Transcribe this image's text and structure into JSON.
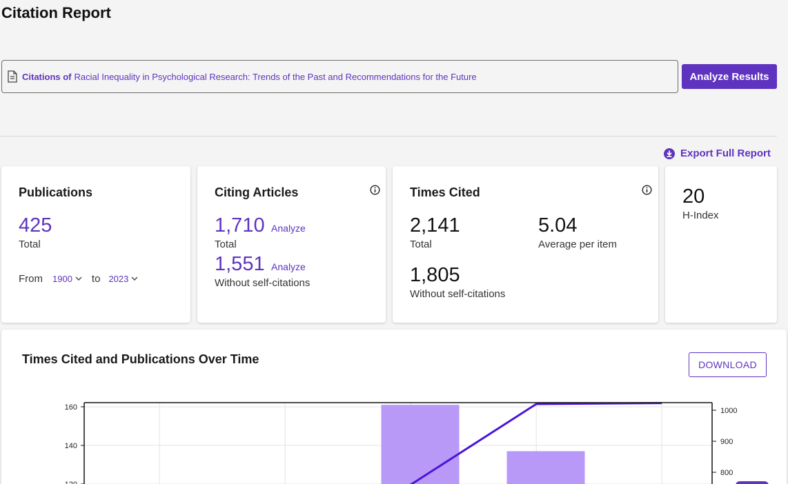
{
  "page": {
    "title": "Citation Report"
  },
  "citation": {
    "prefix": "Citations of",
    "title": "Racial Inequality in Psychological Research: Trends of the Past and Recommendations for the Future"
  },
  "actions": {
    "analyze_results": "Analyze Results",
    "export_full_report": "Export Full Report"
  },
  "publications": {
    "title": "Publications",
    "total": "425",
    "total_label": "Total",
    "from_label": "From",
    "from_year": "1900",
    "to_label": "to",
    "to_year": "2023"
  },
  "citing_articles": {
    "title": "Citing Articles",
    "total": "1,710",
    "total_analyze": "Analyze",
    "total_label": "Total",
    "without_self": "1,551",
    "without_self_analyze": "Analyze",
    "without_self_label": "Without self-citations"
  },
  "times_cited": {
    "title": "Times Cited",
    "total": "2,141",
    "total_label": "Total",
    "average": "5.04",
    "average_label": "Average per item",
    "without_self": "1,805",
    "without_self_label": "Without self-citations"
  },
  "h_index": {
    "value": "20",
    "label": "H-Index"
  },
  "chart_section": {
    "title": "Times Cited and Publications Over Time",
    "download_label": "DOWNLOAD"
  },
  "colors": {
    "accent": "#5e33bf",
    "bar": "#b899f7",
    "line": "#4a14d6"
  },
  "icons": [
    "document-icon",
    "download-circle-icon",
    "info-icon",
    "chevron-down-icon"
  ],
  "chart_data": {
    "type": "bar",
    "title": "Times Cited and Publications Over Time",
    "left_axis": {
      "ticks": [
        120,
        140,
        160
      ],
      "range": [
        120,
        161
      ]
    },
    "right_axis": {
      "ticks": [
        800,
        900,
        1000
      ],
      "range": [
        770,
        1025
      ]
    },
    "categories": [
      "",
      "",
      "",
      "",
      ""
    ],
    "series": [
      {
        "axis": "left",
        "type": "bar",
        "values": [
          null,
          null,
          161,
          137,
          null
        ]
      },
      {
        "axis": "right",
        "type": "line",
        "values": [
          null,
          null,
          760,
          1020,
          1023
        ]
      }
    ],
    "grid": true
  }
}
